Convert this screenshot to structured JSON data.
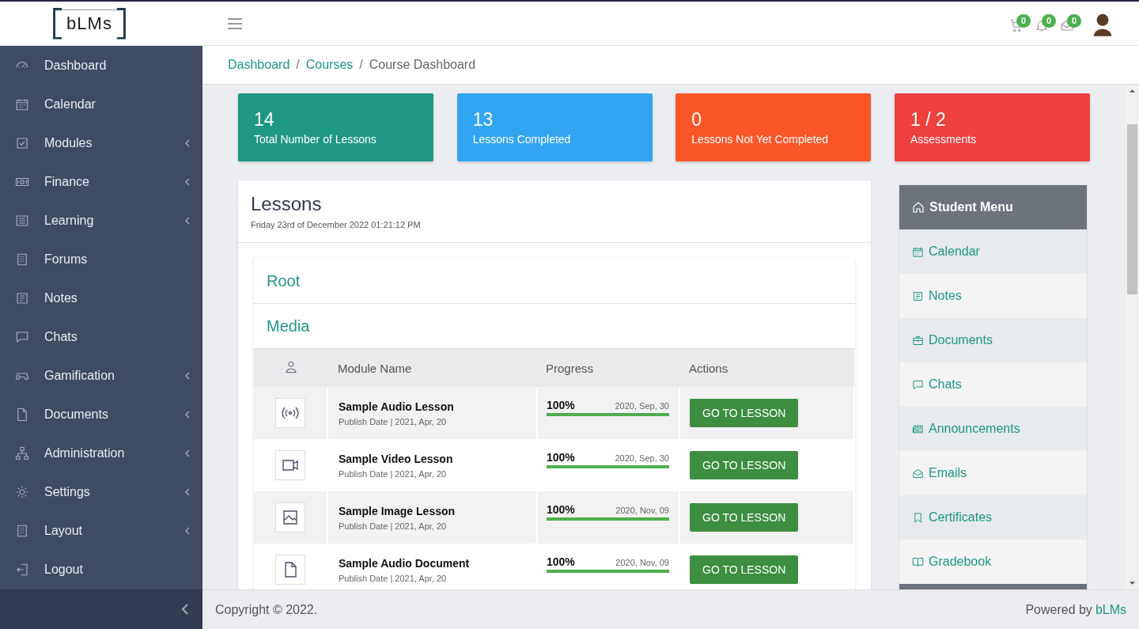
{
  "logo": {
    "text": "bLMs"
  },
  "top_icons": [
    {
      "kind": "cart",
      "badge": "0"
    },
    {
      "kind": "bell",
      "badge": "0"
    },
    {
      "kind": "mail",
      "badge": "0"
    }
  ],
  "sidebar": {
    "items": [
      {
        "label": "Dashboard",
        "kind": "gauge",
        "has_submenu": false
      },
      {
        "label": "Calendar",
        "kind": "calendar",
        "has_submenu": false
      },
      {
        "label": "Modules",
        "kind": "check",
        "has_submenu": true
      },
      {
        "label": "Finance",
        "kind": "money",
        "has_submenu": true
      },
      {
        "label": "Learning",
        "kind": "list",
        "has_submenu": true
      },
      {
        "label": "Forums",
        "kind": "building",
        "has_submenu": false
      },
      {
        "label": "Notes",
        "kind": "note",
        "has_submenu": false
      },
      {
        "label": "Chats",
        "kind": "chat",
        "has_submenu": false
      },
      {
        "label": "Gamification",
        "kind": "gamepad",
        "has_submenu": true
      },
      {
        "label": "Documents",
        "kind": "file",
        "has_submenu": true
      },
      {
        "label": "Administration",
        "kind": "sitemap",
        "has_submenu": true
      },
      {
        "label": "Settings",
        "kind": "gear",
        "has_submenu": true
      },
      {
        "label": "Layout",
        "kind": "building",
        "has_submenu": true
      },
      {
        "label": "Logout",
        "kind": "logout",
        "has_submenu": false
      }
    ]
  },
  "breadcrumb": {
    "separator": "/",
    "items": [
      {
        "label": "Dashboard",
        "link": true
      },
      {
        "label": "Courses",
        "link": true
      },
      {
        "label": "Course Dashboard",
        "link": false
      }
    ]
  },
  "stats": [
    {
      "value": "14",
      "label": "Total Number of Lessons",
      "color": "#1e9784"
    },
    {
      "value": "13",
      "label": "Lessons Completed",
      "color": "#32a5f2"
    },
    {
      "value": "0",
      "label": "Lessons Not Yet Completed",
      "color": "#fb5628"
    },
    {
      "value": "1 / 2",
      "label": "Assessments",
      "color": "#ee403d"
    }
  ],
  "lessons": {
    "title": "Lessons",
    "timestamp": "Friday 23rd of December 2022 01:21:12 PM",
    "sections": [
      "Root",
      "Media"
    ],
    "table": {
      "columns": [
        "Module Name",
        "Progress",
        "Actions"
      ],
      "rows": [
        {
          "kind": "audio",
          "name": "Sample Audio Lesson",
          "publish": "Publish Date | 2021, Apr, 20",
          "progress": "100%",
          "level": 1,
          "date": "2020, Sep, 30",
          "action": "GO TO LESSON"
        },
        {
          "kind": "video",
          "name": "Sample Video Lesson",
          "publish": "Publish Date | 2021, Apr, 20",
          "progress": "100%",
          "level": 1,
          "date": "2020, Sep, 30",
          "action": "GO TO LESSON"
        },
        {
          "kind": "image",
          "name": "Sample Image Lesson",
          "publish": "Publish Date | 2021, Apr, 20",
          "progress": "100%",
          "level": 1,
          "date": "2020, Nov, 09",
          "action": "GO TO LESSON"
        },
        {
          "kind": "document",
          "name": "Sample Audio Document",
          "publish": "Publish Date | 2021, Apr, 20",
          "progress": "100%",
          "level": 1,
          "date": "2020, Nov, 09",
          "action": "GO TO LESSON"
        }
      ]
    }
  },
  "student_menu": {
    "title": "Student Menu",
    "items": [
      {
        "label": "Calendar",
        "kind": "calendar"
      },
      {
        "label": "Notes",
        "kind": "note"
      },
      {
        "label": "Documents",
        "kind": "briefcase"
      },
      {
        "label": "Chats",
        "kind": "chat"
      },
      {
        "label": "Announcements",
        "kind": "news"
      },
      {
        "label": "Emails",
        "kind": "mail"
      },
      {
        "label": "Certificates",
        "kind": "bookmark"
      },
      {
        "label": "Gradebook",
        "kind": "book"
      }
    ]
  },
  "footer": {
    "copyright": "Copyright © 2022.",
    "powered_by": "Powered by",
    "brand": "bLMs"
  }
}
